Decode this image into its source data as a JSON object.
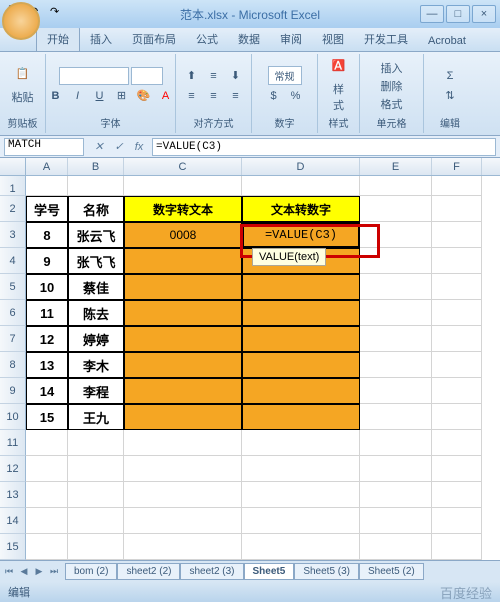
{
  "titlebar": {
    "title": "范本.xlsx - Microsoft Excel"
  },
  "tabs": [
    "开始",
    "插入",
    "页面布局",
    "公式",
    "数据",
    "审阅",
    "视图",
    "开发工具",
    "Acrobat"
  ],
  "ribbon": {
    "paste": "粘贴",
    "clipboard": "剪贴板",
    "font": "字体",
    "align": "对齐方式",
    "number": "数字",
    "general": "常规",
    "styles": "样式",
    "cells": "单元格",
    "editing": "编辑",
    "insert": "插入",
    "delete": "删除",
    "format": "格式"
  },
  "namebox": "MATCH",
  "formula": "=VALUE(C3)",
  "cols": [
    "A",
    "B",
    "C",
    "D",
    "E",
    "F"
  ],
  "rowCount": 15,
  "rowStart": 1,
  "headers": {
    "id": "学号",
    "name": "名称",
    "num2txt": "数字转文本",
    "txt2num": "文本转数字"
  },
  "data": [
    {
      "id": "8",
      "name": "张云飞",
      "c": "0008"
    },
    {
      "id": "9",
      "name": "张飞飞",
      "c": ""
    },
    {
      "id": "10",
      "name": "蔡佳",
      "c": ""
    },
    {
      "id": "11",
      "name": "陈去",
      "c": ""
    },
    {
      "id": "12",
      "name": "婷婷",
      "c": ""
    },
    {
      "id": "13",
      "name": "李木",
      "c": ""
    },
    {
      "id": "14",
      "name": "李程",
      "c": ""
    },
    {
      "id": "15",
      "name": "王九",
      "c": ""
    }
  ],
  "activeCell": {
    "text": "=VALUE(C3)",
    "tooltip": "VALUE(text)"
  },
  "sheetTabs": [
    "bom (2)",
    "sheet2 (2)",
    "sheet2 (3)",
    "Sheet5",
    "Sheet5 (3)",
    "Sheet5 (2)"
  ],
  "activeSheet": "Sheet5",
  "status": "编辑",
  "watermark": "百度经验"
}
